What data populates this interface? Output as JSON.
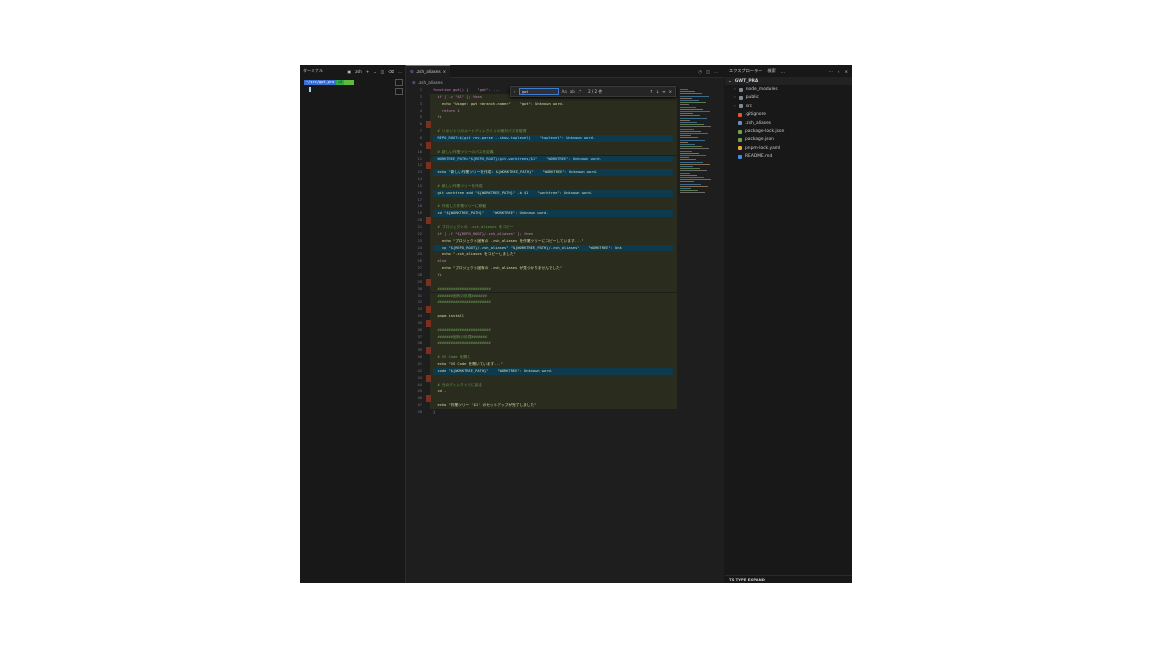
{
  "terminal": {
    "title": "ターミナル",
    "shell": "zsh",
    "prompt_segment_1": "~/src/gwt_pra",
    "prompt_segment_2": "⎇"
  },
  "editor": {
    "tab_label": ".zsh_aliases",
    "breadcrumb": ".zsh_aliases",
    "find": {
      "query": "gwt",
      "count": "2 / 2 件",
      "opt_case": "Aa",
      "opt_word": "ab",
      "opt_regex": ".*"
    },
    "lines": [
      {
        "n": "1",
        "t": "function gwt() {    \"gwt\": ..."
      },
      {
        "n": "2",
        "t": "  if [ -z \"$1\" ]; then"
      },
      {
        "n": "3",
        "t": "    echo \"Usage: gwt <branch-name>\"    \"gwt\": Unknown word."
      },
      {
        "n": "4",
        "t": "    return 1"
      },
      {
        "n": "5",
        "t": "  fi"
      },
      {
        "n": "6",
        "t": ""
      },
      {
        "n": "7",
        "t": "  # リポジトリのルートディレクトリの絶対パスを取得"
      },
      {
        "n": "8",
        "t": "  REPO_ROOT=$(git rev-parse --show-toplevel)    \"toplevel\": Unknown word."
      },
      {
        "n": "9",
        "t": ""
      },
      {
        "n": "10",
        "t": "  # 新しい作業ツリーのパスを定義"
      },
      {
        "n": "11",
        "t": "  WORKTREE_PATH=\"${REPO_ROOT}/git-worktrees/$1\"    \"WORKTREE\": Unknown word."
      },
      {
        "n": "12",
        "t": ""
      },
      {
        "n": "13",
        "t": "  echo \"新しい作業ツリーを作成: ${WORKTREE_PATH}\"    \"WORKTREE\": Unknown word."
      },
      {
        "n": "14",
        "t": ""
      },
      {
        "n": "15",
        "t": "  # 新しい作業ツリーを作成"
      },
      {
        "n": "16",
        "t": "  git worktree add \"${WORKTREE_PATH}\" -b $1    \"worktree\": Unknown word."
      },
      {
        "n": "17",
        "t": ""
      },
      {
        "n": "18",
        "t": "  # 作成した作業ツリーに移動"
      },
      {
        "n": "19",
        "t": "  cd \"${WORKTREE_PATH}\"    \"WORKTREE\": Unknown word."
      },
      {
        "n": "20",
        "t": ""
      },
      {
        "n": "21",
        "t": "  # プロジェクトの .zsh_aliases をコピー"
      },
      {
        "n": "22",
        "t": "  if [ -f \"${REPO_ROOT}/.zsh_aliases\" ]; then"
      },
      {
        "n": "23",
        "t": "    echo \"プロジェクト固有の .zsh_aliases を作業ツリーにコピーしています...\""
      },
      {
        "n": "24",
        "t": "    cp \"${REPO_ROOT}/.zsh_aliases\" \"${WORKTREE_PATH}/.zsh_aliases\"    \"WORKTREE\": Unk"
      },
      {
        "n": "25",
        "t": "    echo \".zsh_aliases をコピーしました\""
      },
      {
        "n": "26",
        "t": "  else"
      },
      {
        "n": "27",
        "t": "    echo \"プロジェクト固有の .zsh_aliases が見つかりませんでした\""
      },
      {
        "n": "28",
        "t": "  fi"
      },
      {
        "n": "29",
        "t": ""
      },
      {
        "n": "30",
        "t": "  ########################"
      },
      {
        "n": "31",
        "t": "  #######固有の処理#######"
      },
      {
        "n": "32",
        "t": "  ########################"
      },
      {
        "n": "33",
        "t": ""
      },
      {
        "n": "34",
        "t": "  pnpm install"
      },
      {
        "n": "35",
        "t": ""
      },
      {
        "n": "36",
        "t": "  ########################"
      },
      {
        "n": "37",
        "t": "  #######固有の処理#######"
      },
      {
        "n": "38",
        "t": "  ########################"
      },
      {
        "n": "39",
        "t": ""
      },
      {
        "n": "40",
        "t": "  # VS Code を開く"
      },
      {
        "n": "41",
        "t": "  echo \"VS Code を開いています...\""
      },
      {
        "n": "42",
        "t": "  code \"${WORKTREE_PATH}\"    \"WORKTREE\": Unknown word."
      },
      {
        "n": "43",
        "t": ""
      },
      {
        "n": "44",
        "t": "  # 元のディレクトリに戻る"
      },
      {
        "n": "45",
        "t": "  cd -"
      },
      {
        "n": "46",
        "t": ""
      },
      {
        "n": "47",
        "t": "  echo \"作業ツリー '$1' のセットアップが完了しました\""
      },
      {
        "n": "48",
        "t": "}"
      }
    ]
  },
  "explorer": {
    "title": "エクスプローラー",
    "secondary": "検索",
    "root": "GWT_PRA",
    "items": [
      {
        "label": "node_modules",
        "icon": "folder-icon",
        "color": "#7e8c9a"
      },
      {
        "label": "public",
        "icon": "folder-icon",
        "color": "#7e8c9a"
      },
      {
        "label": "src",
        "icon": "folder-icon",
        "color": "#7e8c9a"
      },
      {
        "label": ".gitignore",
        "icon": "git-icon",
        "color": "#e0562e"
      },
      {
        "label": ".zsh_aliases",
        "icon": "gear-icon",
        "color": "#6c8ebf"
      },
      {
        "label": "package-lock.json",
        "icon": "npm-icon",
        "color": "#6fa34d"
      },
      {
        "label": "package.json",
        "icon": "npm-icon",
        "color": "#6fa34d"
      },
      {
        "label": "pnpm-lock.yaml",
        "icon": "pnpm-icon",
        "color": "#f3a33c"
      },
      {
        "label": "README.md",
        "icon": "info-icon",
        "color": "#3c8ee6"
      }
    ],
    "outline": "TS TYPE EXPAND"
  }
}
